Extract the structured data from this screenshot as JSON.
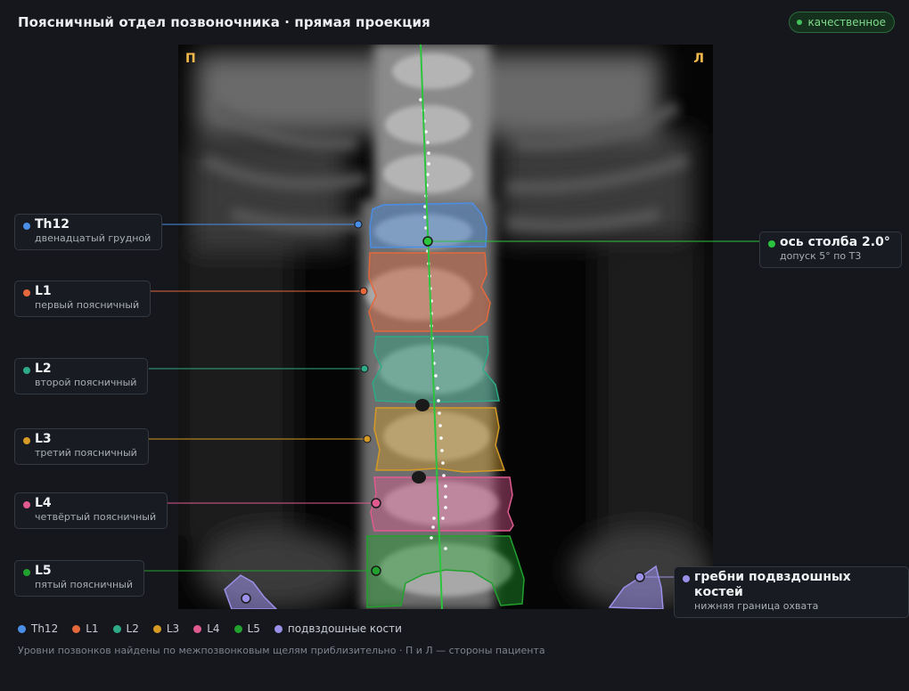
{
  "header": {
    "title": "Поясничный отдел позвоночника · прямая проекция",
    "quality_badge": "качественное"
  },
  "scan": {
    "left_marker": "П",
    "right_marker": "Л"
  },
  "levels": [
    {
      "id": "th12",
      "name": "Th12",
      "sub": "двенадцатый грудной",
      "color": "#4a8ee6"
    },
    {
      "id": "l1",
      "name": "L1",
      "sub": "первый поясничный",
      "color": "#e4683c"
    },
    {
      "id": "l2",
      "name": "L2",
      "sub": "второй поясничный",
      "color": "#2eaa86"
    },
    {
      "id": "l3",
      "name": "L3",
      "sub": "третий поясничный",
      "color": "#d59a24"
    },
    {
      "id": "l4",
      "name": "L4",
      "sub": "четвёртый поясничный",
      "color": "#e05a90"
    },
    {
      "id": "l5",
      "name": "L5",
      "sub": "пятый поясничный",
      "color": "#22a12e"
    }
  ],
  "axis": {
    "name": "ось столба 2.0°",
    "sub": "допуск 5° по Т3",
    "color": "#2bc43d"
  },
  "iliac": {
    "name": "гребни подвздошных костей",
    "sub": "нижняя граница охвата",
    "color": "#9a90e8"
  },
  "legend": [
    {
      "label": "Th12",
      "color": "#4a8ee6"
    },
    {
      "label": "L1",
      "color": "#e4683c"
    },
    {
      "label": "L2",
      "color": "#2eaa86"
    },
    {
      "label": "L3",
      "color": "#d59a24"
    },
    {
      "label": "L4",
      "color": "#e05a90"
    },
    {
      "label": "L5",
      "color": "#22a12e"
    },
    {
      "label": "подвздошные кости",
      "color": "#9a90e8"
    }
  ],
  "footnote": "Уровни позвонков найдены по межпозвонковым щелям приблизительно · П и Л — стороны пациента"
}
